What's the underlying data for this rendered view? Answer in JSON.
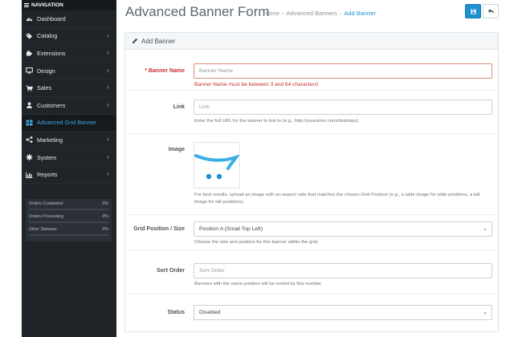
{
  "sidebar": {
    "header": "NAVIGATION",
    "items": [
      {
        "label": "Dashboard",
        "icon": "dashboard-icon",
        "chevron": false
      },
      {
        "label": "Catalog",
        "icon": "tag-icon",
        "chevron": true
      },
      {
        "label": "Extensions",
        "icon": "puzzle-icon",
        "chevron": true
      },
      {
        "label": "Design",
        "icon": "monitor-icon",
        "chevron": true
      },
      {
        "label": "Sales",
        "icon": "cart-icon",
        "chevron": true
      },
      {
        "label": "Customers",
        "icon": "user-icon",
        "chevron": true
      },
      {
        "label": "Advanced Grid Banner",
        "icon": "grid-icon",
        "chevron": false,
        "active": true
      },
      {
        "label": "Marketing",
        "icon": "share-icon",
        "chevron": true
      },
      {
        "label": "System",
        "icon": "cog-icon",
        "chevron": true
      },
      {
        "label": "Reports",
        "icon": "bar-chart-icon",
        "chevron": true
      }
    ],
    "stats": [
      {
        "label": "Orders Completed",
        "value": "0%"
      },
      {
        "label": "Orders Processing",
        "value": "0%"
      },
      {
        "label": "Other Statuses",
        "value": "0%"
      }
    ]
  },
  "header": {
    "title": "Advanced Banner Form",
    "breadcrumb": [
      "Home",
      "Advanced Banners",
      "Add Banner"
    ]
  },
  "panel": {
    "heading": "Add Banner"
  },
  "form": {
    "banner_name": {
      "label": "Banner Name",
      "placeholder": "Banner Name",
      "value": "",
      "error": "Banner Name must be between 3 and 64 characters!"
    },
    "link": {
      "label": "Link",
      "placeholder": "Link",
      "value": "",
      "help": "Enter the full URL for the banner to link to (e.g., http://yourstore.com/desktops)."
    },
    "image": {
      "label": "Image",
      "help": "For best results, upload an image with an aspect ratio that matches the chosen Grid Position (e.g., a wide image for wide positions, a tall image for tall positions)."
    },
    "grid_position": {
      "label": "Grid Position / Size",
      "selected": "Position A (Small Top Left)",
      "help": "Choose the size and position for this banner within the grid."
    },
    "sort_order": {
      "label": "Sort Order",
      "placeholder": "Sort Order",
      "value": "",
      "help": "Banners with the same position will be sorted by this number."
    },
    "status": {
      "label": "Status",
      "selected": "Disabled"
    }
  },
  "colors": {
    "accent": "#1e91cf",
    "error": "#c9302c",
    "sidebar_bg": "#1f2428"
  }
}
